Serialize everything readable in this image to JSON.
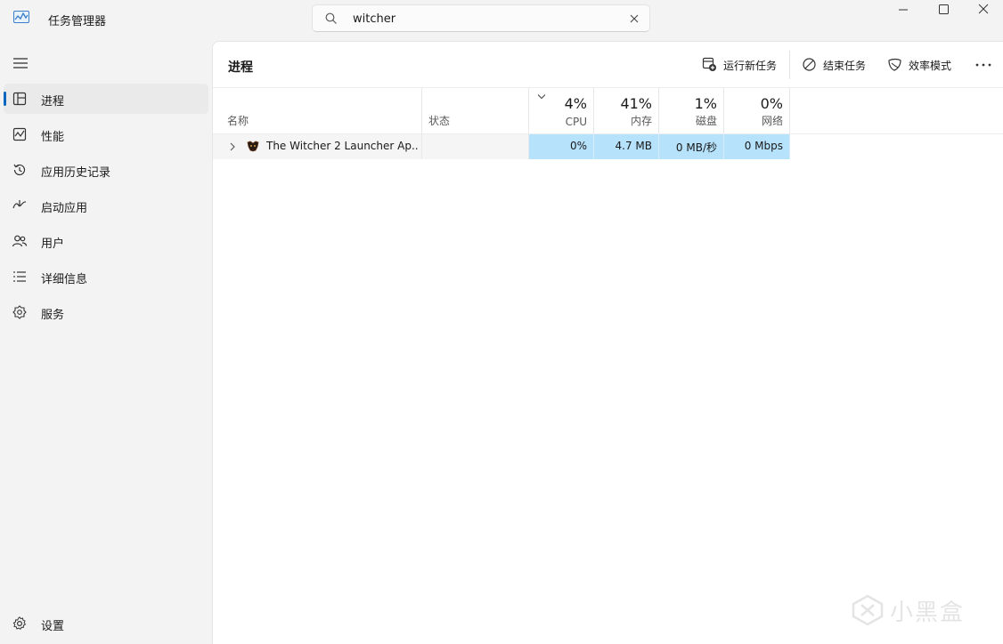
{
  "app": {
    "title": "任务管理器"
  },
  "search": {
    "value": "witcher",
    "placeholder": ""
  },
  "sidebar": {
    "items": [
      {
        "label": "进程",
        "icon": "processes-icon",
        "active": true
      },
      {
        "label": "性能",
        "icon": "performance-icon"
      },
      {
        "label": "应用历史记录",
        "icon": "app-history-icon"
      },
      {
        "label": "启动应用",
        "icon": "startup-apps-icon"
      },
      {
        "label": "用户",
        "icon": "users-icon"
      },
      {
        "label": "详细信息",
        "icon": "details-icon"
      },
      {
        "label": "服务",
        "icon": "services-icon"
      }
    ],
    "settings": {
      "label": "设置",
      "icon": "gear-icon"
    }
  },
  "main": {
    "title": "进程",
    "toolbar": {
      "run_new_task": "运行新任务",
      "end_task": "结束任务",
      "efficiency_mode": "效率模式"
    }
  },
  "table": {
    "columns": {
      "name": "名称",
      "status": "状态",
      "cpu": {
        "label": "CPU",
        "percent": "4%"
      },
      "memory": {
        "label": "内存",
        "percent": "41%"
      },
      "disk": {
        "label": "磁盘",
        "percent": "1%"
      },
      "network": {
        "label": "网络",
        "percent": "0%"
      }
    },
    "rows": [
      {
        "name": "The Witcher 2 Launcher Ap...",
        "status": "",
        "cpu": "0%",
        "memory": "4.7 MB",
        "disk": "0 MB/秒",
        "network": "0 Mbps"
      }
    ]
  },
  "colors": {
    "accent": "#0067c0",
    "highlight": "#b6e2fb"
  },
  "watermark": {
    "text": "小黑盒"
  }
}
